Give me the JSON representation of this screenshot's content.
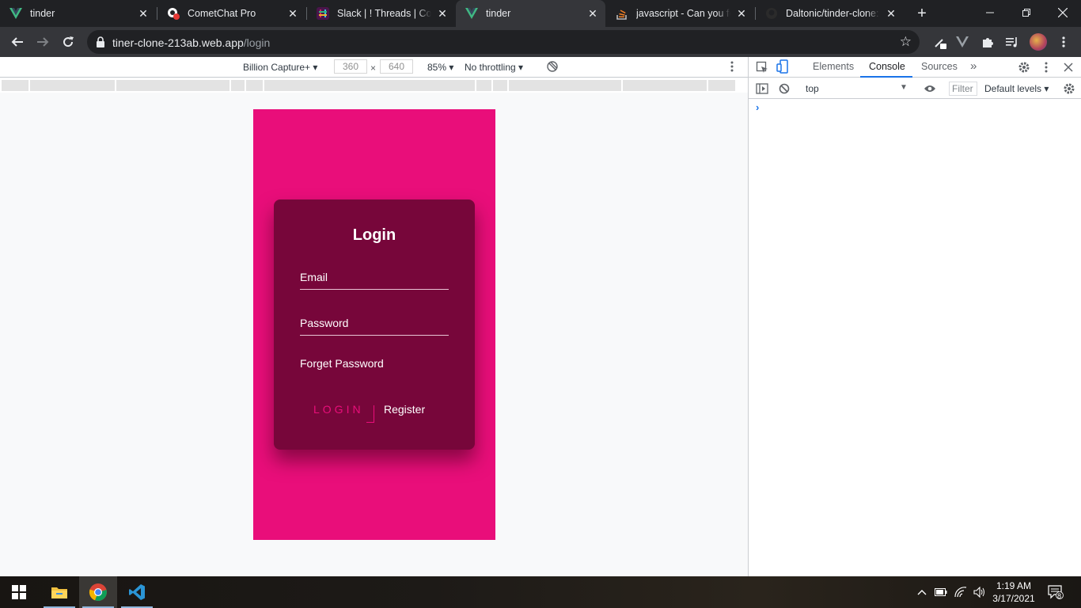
{
  "browser": {
    "tabs": [
      {
        "title": "tinder",
        "icon": "vue-icon",
        "active": false
      },
      {
        "title": "CometChat Pro",
        "icon": "cometchat-icon",
        "active": false
      },
      {
        "title": "Slack | ! Threads | Comet",
        "icon": "slack-icon",
        "active": false
      },
      {
        "title": "tinder",
        "icon": "vue-icon",
        "active": true
      },
      {
        "title": "javascript - Can you force",
        "icon": "stackoverflow-icon",
        "active": false
      },
      {
        "title": "Daltonic/tinder-clone: A",
        "icon": "github-icon",
        "active": false
      }
    ],
    "url_host": "tiner-clone-213ab.web.app",
    "url_path": "/login"
  },
  "device_toolbar": {
    "device": "Billion Capture+",
    "width": "360",
    "times": "×",
    "height": "640",
    "zoom": "85%",
    "throttling": "No throttling"
  },
  "app": {
    "heading": "Login",
    "email_placeholder": "Email",
    "password_placeholder": "Password",
    "forgot_label": "Forget Password",
    "login_label": "LOGIN",
    "register_label": "Register",
    "colors": {
      "background": "#e90e7a",
      "card": "#77063a",
      "accent": "#e90e7a"
    }
  },
  "devtools": {
    "tabs": [
      "Elements",
      "Console",
      "Sources"
    ],
    "active_tab": "Console",
    "context": "top",
    "filter_placeholder": "Filter",
    "levels": "Default levels",
    "prompt": "›"
  },
  "taskbar": {
    "time": "1:19 AM",
    "date": "3/17/2021",
    "notification_count": "8"
  }
}
